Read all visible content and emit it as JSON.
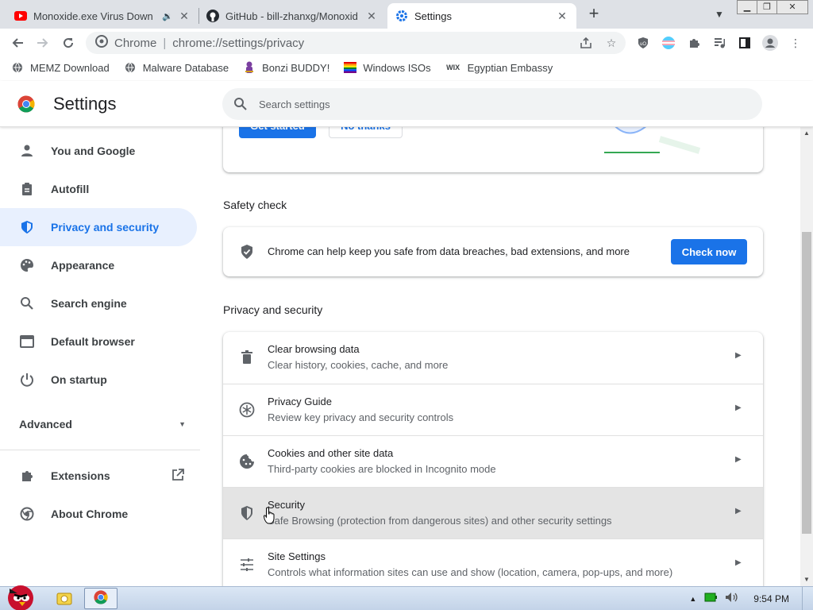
{
  "browser": {
    "tabs": [
      {
        "title": "Monoxide.exe Virus Down",
        "favicon": "youtube-icon",
        "audio": true
      },
      {
        "title": "GitHub - bill-zhanxg/Monoxid",
        "favicon": "github-icon"
      },
      {
        "title": "Settings",
        "favicon": "gear-icon",
        "active": true
      }
    ],
    "omnibox": {
      "label": "Chrome",
      "separator": "|",
      "url": "chrome://settings/privacy"
    },
    "bookmarks": [
      {
        "label": "MEMZ Download",
        "icon": "globe-icon"
      },
      {
        "label": "Malware Database",
        "icon": "globe-icon"
      },
      {
        "label": "Bonzi BUDDY!",
        "icon": "bonzi-icon"
      },
      {
        "label": "Windows ISOs",
        "icon": "rainbow-flag-icon"
      },
      {
        "label": "Egyptian Embassy",
        "icon": "wix-icon"
      }
    ],
    "extension_labels": {
      "ublock": "uO"
    }
  },
  "settings": {
    "title": "Settings",
    "search_placeholder": "Search settings",
    "nav": [
      {
        "label": "You and Google",
        "icon": "person-icon"
      },
      {
        "label": "Autofill",
        "icon": "clipboard-icon"
      },
      {
        "label": "Privacy and security",
        "icon": "shield-icon",
        "selected": true
      },
      {
        "label": "Appearance",
        "icon": "palette-icon"
      },
      {
        "label": "Search engine",
        "icon": "search-icon"
      },
      {
        "label": "Default browser",
        "icon": "browser-window-icon"
      },
      {
        "label": "On startup",
        "icon": "power-icon"
      }
    ],
    "advanced_label": "Advanced",
    "nav_bottom": [
      {
        "label": "Extensions",
        "icon": "puzzle-icon"
      },
      {
        "label": "About Chrome",
        "icon": "chrome-icon"
      }
    ],
    "promo": {
      "primary_button": "Get started",
      "secondary_button": "No thanks"
    },
    "safety_check": {
      "heading": "Safety check",
      "text": "Chrome can help keep you safe from data breaches, bad extensions, and more",
      "button": "Check now"
    },
    "privacy": {
      "heading": "Privacy and security",
      "rows": [
        {
          "title": "Clear browsing data",
          "subtitle": "Clear history, cookies, cache, and more",
          "icon": "trash-icon"
        },
        {
          "title": "Privacy Guide",
          "subtitle": "Review key privacy and security controls",
          "icon": "privacy-guide-icon"
        },
        {
          "title": "Cookies and other site data",
          "subtitle": "Third-party cookies are blocked in Incognito mode",
          "icon": "cookie-icon"
        },
        {
          "title": "Security",
          "subtitle": "Safe Browsing (protection from dangerous sites) and other security settings",
          "icon": "security-shield-icon",
          "hovered": true
        },
        {
          "title": "Site Settings",
          "subtitle": "Controls what information sites can use and show (location, camera, pop-ups, and more)",
          "icon": "sliders-icon"
        }
      ]
    }
  },
  "taskbar": {
    "clock": "9:54 PM"
  },
  "colors": {
    "accent": "#1a73e8",
    "selected_bg": "#e8f0fe",
    "tabstrip": "#dee1e6"
  }
}
